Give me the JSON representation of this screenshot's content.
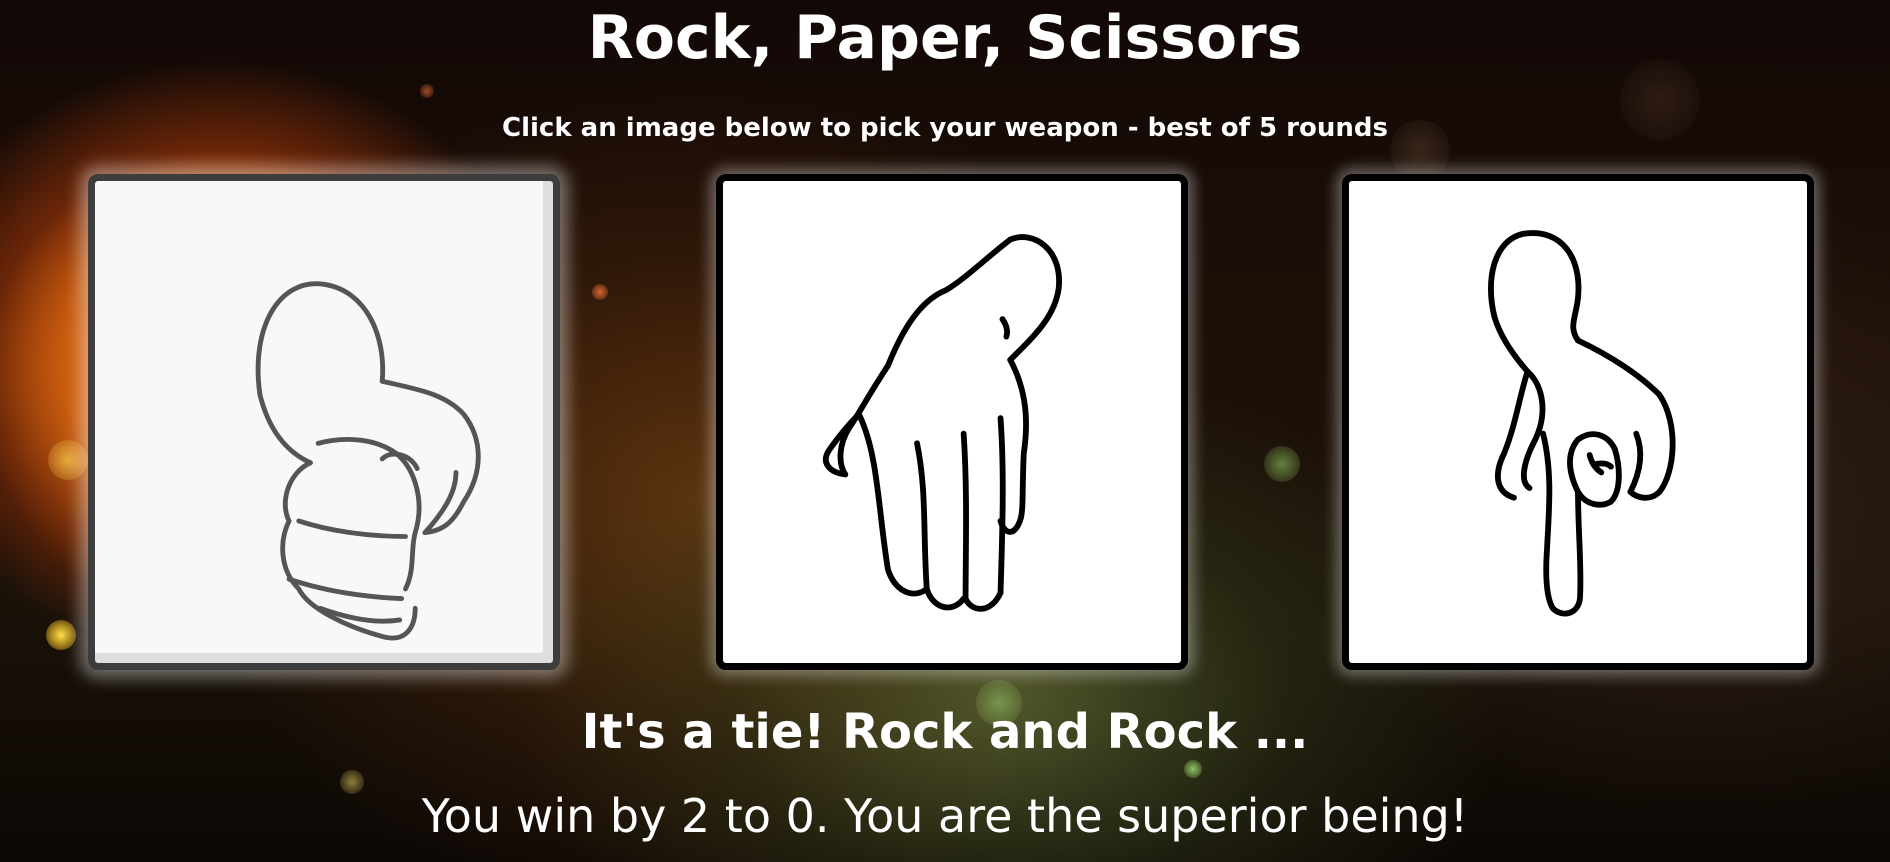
{
  "game": {
    "title": "Rock, Paper, Scissors",
    "instructions": "Click an image below to pick your weapon - best of 5 rounds"
  },
  "choices": [
    {
      "name": "Rock",
      "icon": "rock-hand-icon",
      "selected": true
    },
    {
      "name": "Paper",
      "icon": "paper-hand-icon",
      "selected": false
    },
    {
      "name": "Scissors",
      "icon": "scissors-hand-icon",
      "selected": false
    }
  ],
  "status": {
    "round_result": "It's a tie! Rock and Rock ...",
    "score_message": "You win by 2 to 0. You are the superior being!"
  },
  "colors": {
    "text": "#ffffff",
    "card_border": "#000000",
    "card_background": "#ffffff",
    "background_glow": "#d25b10"
  }
}
